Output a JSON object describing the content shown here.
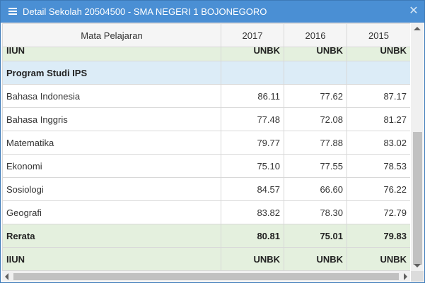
{
  "window": {
    "title": "Detail Sekolah 20504500 - SMA NEGERI 1 BOJONEGORO",
    "menu_icon": "hamburger-menu-icon",
    "close_label": "✕"
  },
  "colors": {
    "titlebar": "#4a8fd4",
    "group_row": "#dcecf7",
    "summary_row": "#e4f0de"
  },
  "table": {
    "headers": [
      "Mata Pelajaran",
      "2017",
      "2016",
      "2015"
    ],
    "top_iiun": {
      "label": "IIUN",
      "values": [
        "UNBK",
        "UNBK",
        "UNBK"
      ]
    },
    "group_label": "Program Studi IPS",
    "rows": [
      {
        "subject": "Bahasa Indonesia",
        "values": [
          "86.11",
          "77.62",
          "87.17"
        ]
      },
      {
        "subject": "Bahasa Inggris",
        "values": [
          "77.48",
          "72.08",
          "81.27"
        ]
      },
      {
        "subject": "Matematika",
        "values": [
          "79.77",
          "77.88",
          "83.02"
        ]
      },
      {
        "subject": "Ekonomi",
        "values": [
          "75.10",
          "77.55",
          "78.53"
        ]
      },
      {
        "subject": "Sosiologi",
        "values": [
          "84.57",
          "66.60",
          "76.22"
        ]
      },
      {
        "subject": "Geografi",
        "values": [
          "83.82",
          "78.30",
          "72.79"
        ]
      }
    ],
    "rerata": {
      "label": "Rerata",
      "values": [
        "80.81",
        "75.01",
        "79.83"
      ]
    },
    "bottom_iiun": {
      "label": "IIUN",
      "values": [
        "UNBK",
        "UNBK",
        "UNBK"
      ]
    }
  }
}
